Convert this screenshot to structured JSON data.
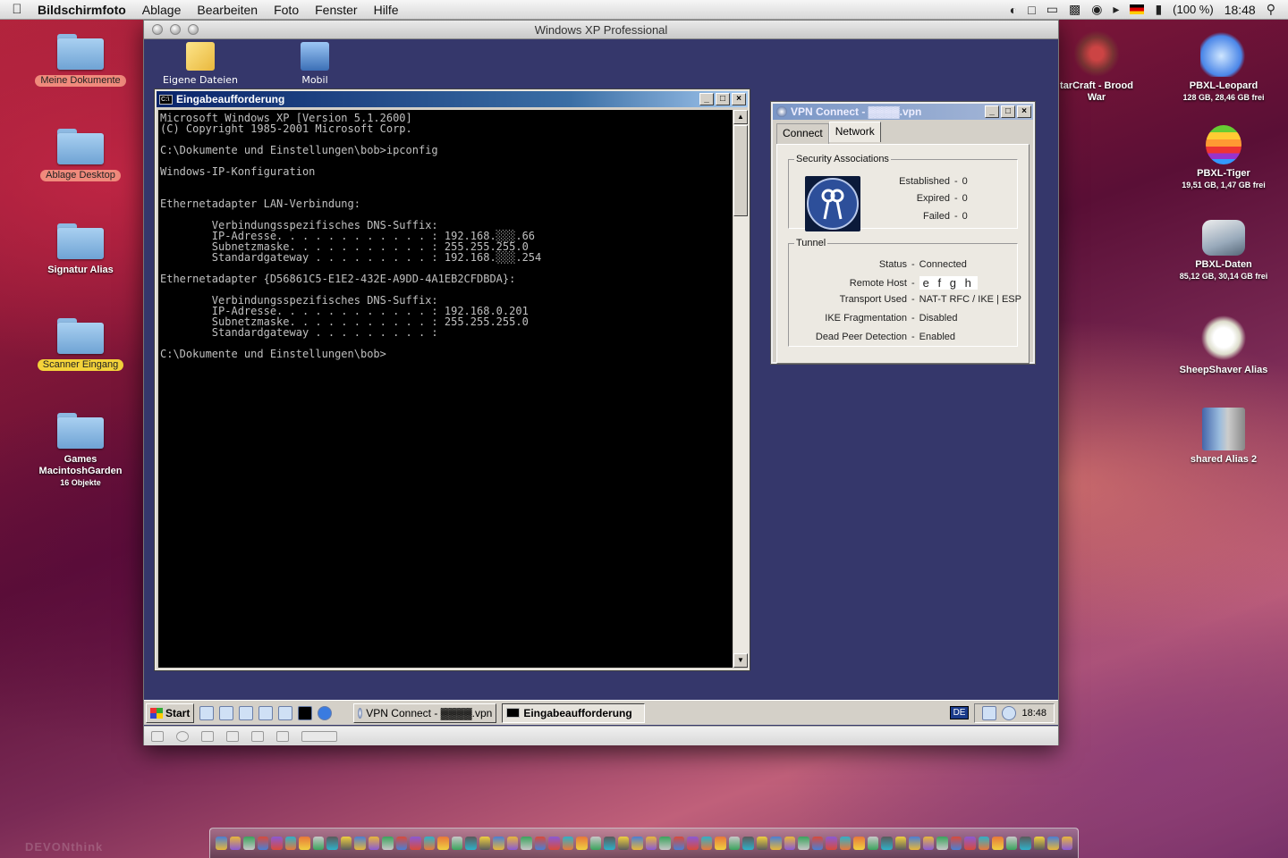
{
  "menubar": {
    "app": "Bildschirmfoto",
    "items": [
      "Ablage",
      "Bearbeiten",
      "Foto",
      "Fenster",
      "Hilfe"
    ],
    "battery": "(100 %)",
    "clock": "18:48"
  },
  "desktop_left": [
    {
      "label": "Meine Dokumente",
      "tag": "red"
    },
    {
      "label": "Ablage Desktop",
      "tag": "red"
    },
    {
      "label": "Signatur Alias",
      "tag": ""
    },
    {
      "label": "Scanner Eingang",
      "tag": "yellow"
    },
    {
      "label": "Games MacintoshGarden",
      "sub": "16 Objekte",
      "tag": ""
    }
  ],
  "desktop_right": [
    {
      "label": "tarCraft - Brood War",
      "sub": ""
    },
    {
      "label": "PBXL-Leopard",
      "sub": "128 GB, 28,46 GB frei"
    },
    {
      "label": "PBXL-Tiger",
      "sub": "19,51 GB, 1,47 GB frei"
    },
    {
      "label": "PBXL-Daten",
      "sub": "85,12 GB, 30,14 GB frei"
    },
    {
      "label": "SheepShaver Alias",
      "sub": ""
    },
    {
      "label": "shared Alias 2",
      "sub": ""
    }
  ],
  "vm": {
    "title": "Windows XP Professional",
    "desktop_icons": [
      "Eigene Dateien",
      "Mobil"
    ]
  },
  "cmd": {
    "title": "Eingabeaufforderung",
    "icon_text": "C:\\",
    "output": "Microsoft Windows XP [Version 5.1.2600]\n(C) Copyright 1985-2001 Microsoft Corp.\n\nC:\\Dokumente und Einstellungen\\bob>ipconfig\n\nWindows-IP-Konfiguration\n\n\nEthernetadapter LAN-Verbindung:\n\n        Verbindungsspezifisches DNS-Suffix:\n        IP-Adresse. . . . . . . . . . . . : 192.168.░░░.66\n        Subnetzmaske. . . . . . . . . . . : 255.255.255.0\n        Standardgateway . . . . . . . . . : 192.168.░░░.254\n\nEthernetadapter {D56861C5-E1E2-432E-A9DD-4A1EB2CFDBDA}:\n\n        Verbindungsspezifisches DNS-Suffix:\n        IP-Adresse. . . . . . . . . . . . : 192.168.0.201\n        Subnetzmaske. . . . . . . . . . . : 255.255.255.0\n        Standardgateway . . . . . . . . . :\n\nC:\\Dokumente und Einstellungen\\bob>"
  },
  "vpn": {
    "title": "VPN Connect - ▓▓▓▓.vpn",
    "tabs": [
      "Connect",
      "Network"
    ],
    "active_tab": "Network",
    "security_associations": {
      "legend": "Security Associations",
      "rows": [
        {
          "key": "Established",
          "value": "0"
        },
        {
          "key": "Expired",
          "value": "0"
        },
        {
          "key": "Failed",
          "value": "0"
        }
      ]
    },
    "tunnel": {
      "legend": "Tunnel",
      "rows": [
        {
          "key": "Status",
          "value": "Connected"
        },
        {
          "key": "Remote Host",
          "value": "e f g h"
        },
        {
          "key": "Transport Used",
          "value": "NAT-T RFC / IKE | ESP"
        },
        {
          "key": "IKE Fragmentation",
          "value": "Disabled"
        },
        {
          "key": "Dead Peer Detection",
          "value": "Enabled"
        }
      ]
    }
  },
  "taskbar": {
    "start": "Start",
    "tasks": [
      {
        "label": "VPN Connect - ▓▓▓▓.vpn",
        "active": false
      },
      {
        "label": "Eingabeaufforderung",
        "active": true
      }
    ],
    "lang": "DE",
    "clock": "18:48"
  },
  "watermark": "DEVONthink",
  "colors": {
    "xp_desktop": "#35376b",
    "title_active": "#0a246a",
    "console_bg": "#000000",
    "console_fg": "#c0c0c0"
  }
}
